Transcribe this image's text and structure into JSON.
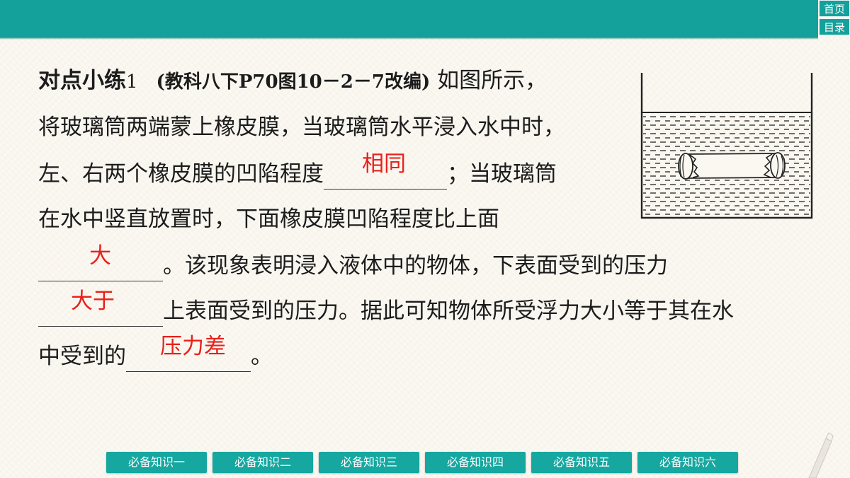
{
  "nav": {
    "home_label": "首页",
    "toc_label": "目录"
  },
  "exercise": {
    "title": "对点小练",
    "number": "1",
    "source": "(教科八下P70图10－2－7改编)",
    "line1_text": " 如图所示，",
    "line2_text": "将玻璃筒两端蒙上橡皮膜，当玻璃筒水平浸入水中时，",
    "line3_before": "左、右两个橡皮膜的凹陷程度",
    "line3_after": "；当玻璃筒",
    "line4_text": "在水中竖直放置时，下面橡皮膜凹陷程度比上面",
    "line5_after": "。该现象表明浸入液体中的物体，下表面受到的压力",
    "line6_after": "上表面受到的压力。据此可知物体所受浮力大小等于其在水",
    "line7_before": "中受到的",
    "line7_after": "。"
  },
  "answers": {
    "a1": "相同",
    "a2": "大",
    "a3": "大于",
    "a4": "压力差"
  },
  "bottom_tabs": [
    "必备知识一",
    "必备知识二",
    "必备知识三",
    "必备知识四",
    "必备知识五",
    "必备知识六"
  ],
  "colors": {
    "header": "#14a09b",
    "answer": "#e8211b",
    "tab": "#16a7a0"
  },
  "figure": {
    "icon": "glass-tube-in-water-diagram"
  }
}
